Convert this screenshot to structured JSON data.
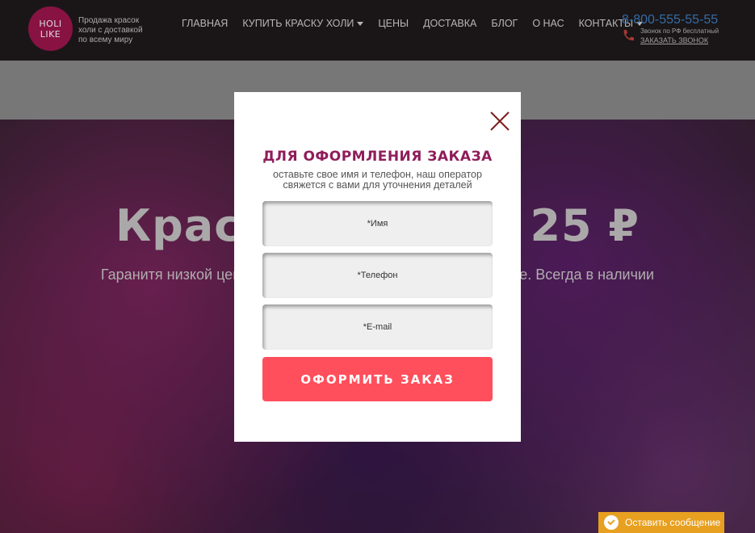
{
  "header": {
    "logo_line1": "HOLI",
    "logo_line2": "LIKE",
    "tagline": "Продажа красок холи с доставкой по всему миру",
    "nav": [
      {
        "label": "ГЛАВНАЯ"
      },
      {
        "label": "КУПИТЬ КРАСКУ ХОЛИ"
      },
      {
        "label": "ЦЕНЫ"
      },
      {
        "label": "ДОСТАВКА"
      },
      {
        "label": "БЛОГ"
      },
      {
        "label": "О НАС"
      },
      {
        "label": "КОНТАКТЫ"
      }
    ],
    "phone": "8-800-555-55-55",
    "phone_note": "Звонок по РФ бесплатный",
    "callback_label": "ЗАКАЗАТЬ ЗВОНОК"
  },
  "hero": {
    "title": "Краска холи от 25 ₽",
    "subtitle": "Гаранитя низкой цены от производителя красок холи - Holi Like. Всегда в наличии на складе."
  },
  "modal": {
    "title": "ДЛЯ ОФОРМЛЕНИЯ ЗАКАЗА",
    "description": "оставьте свое имя и телефон, наш оператор свяжется с вами для уточнения деталей",
    "name_placeholder": "*Имя",
    "phone_placeholder": "*Телефон",
    "email_placeholder": "*E-mail",
    "submit_label": "ОФОРМИТЬ ЗАКАЗ"
  },
  "chat": {
    "label": "Оставить сообщение"
  },
  "colors": {
    "header_bg": "#1f1b1c",
    "brand": "#a0174f",
    "modal_title": "#8f1d5a",
    "submit": "#ff4f5c",
    "phone": "#3f7fc4",
    "chat": "#e8a020"
  },
  "icons": {
    "close": "close-icon",
    "phone": "phone-icon",
    "chat": "chat-bubble-icon"
  }
}
